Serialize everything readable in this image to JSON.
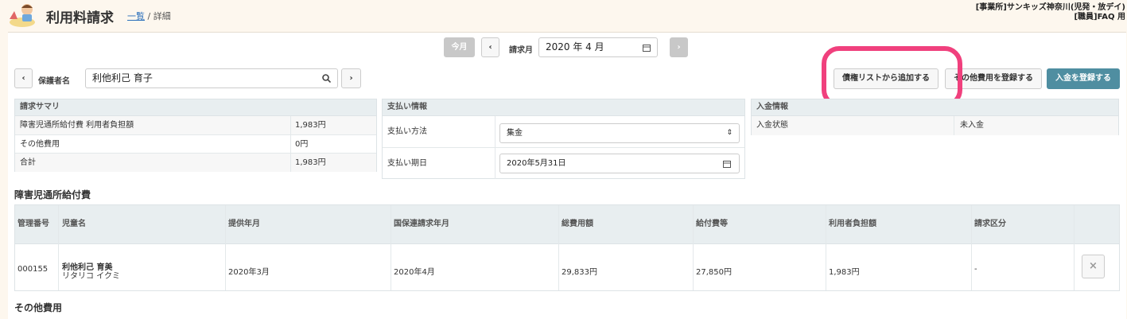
{
  "header": {
    "title": "利用料請求",
    "breadcrumb_link": "一覧",
    "breadcrumb_sep": "/",
    "breadcrumb_current": "詳細",
    "office": "[事業所]サンキッズ神奈川(児発・放デイ)",
    "user": "[職員]FAQ 用"
  },
  "month_nav": {
    "today_label": "今月",
    "prev_icon": "chevron-left",
    "label": "請求月",
    "value": "2020 年 4 月",
    "next_icon": "chevron-right"
  },
  "guardian": {
    "prev_icon": "chevron-left",
    "label": "保護者名",
    "value": "利他利己 育子",
    "next_icon": "chevron-right"
  },
  "actions": {
    "add_from_credit": "債権リストから追加する",
    "register_other": "その他費用を登録する",
    "register_payment": "入金を登録する"
  },
  "summary": {
    "heading": "請求サマリ",
    "rows": [
      {
        "label": "障害児通所給付費 利用者負担額",
        "value": "1,983円"
      },
      {
        "label": "その他費用",
        "value": "0円"
      },
      {
        "label": "合計",
        "value": "1,983円"
      }
    ]
  },
  "payment": {
    "heading": "支払い情報",
    "method_label": "支払い方法",
    "method_value": "集金",
    "due_label": "支払い期日",
    "due_value": "2020年5月31日"
  },
  "deposit": {
    "heading": "入金情報",
    "status_label": "入金状態",
    "status_value": "未入金"
  },
  "benefit": {
    "heading": "障害児通所給付費",
    "columns": [
      "管理番号",
      "児童名",
      "提供年月",
      "国保連請求年月",
      "総費用額",
      "給付費等",
      "利用者負担額",
      "請求区分"
    ],
    "row": {
      "id": "000155",
      "child_name": "利他利己 育美",
      "child_kana": "リタリコ イクミ",
      "service_month": "2020年3月",
      "claim_month": "2020年4月",
      "total": "29,833円",
      "benefit": "27,850円",
      "user_charge": "1,983円",
      "category": "-"
    }
  },
  "other_costs": {
    "heading": "その他費用"
  },
  "colors": {
    "accent": "#4f8ea1",
    "highlight": "#f0407d",
    "background": "#fdf7ee"
  }
}
